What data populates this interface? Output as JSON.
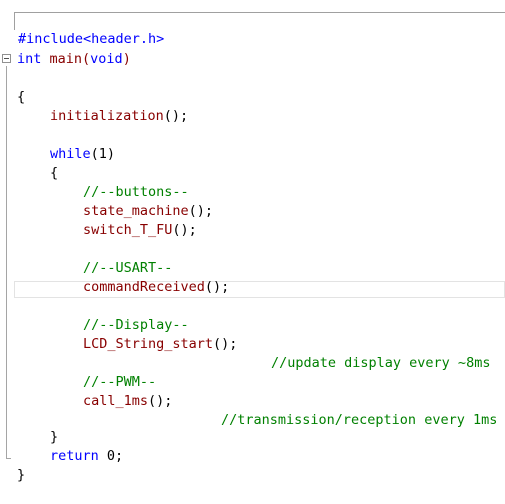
{
  "editor": {
    "lines": {
      "include": "#include<header.h>",
      "main_kw": "int",
      "main_rest": " main(",
      "main_void": "void",
      "main_close": ")",
      "open_brace": "{",
      "init_call": "initialization",
      "init_tail": "();",
      "while_kw": "while",
      "while_cond": "(1)",
      "while_open": "{",
      "cm_buttons": "//--buttons--",
      "state_machine": "state_machine",
      "state_tail": "();",
      "switch": "switch_T_FU",
      "switch_tail": "();",
      "cm_usart": "//--USART--",
      "command": "commandReceived",
      "command_tail": "();",
      "cm_display": "//--Display--",
      "lcd": "LCD_String_start",
      "lcd_tail": "();",
      "cm_update": "//update display every ~8ms",
      "cm_pwm": "//--PWM--",
      "call": "call_1ms",
      "call_tail": "();",
      "cm_trans": "//transmission/reception every 1ms",
      "while_close": "}",
      "return_kw": "return",
      "return_tail": " 0;",
      "close_brace": "}"
    }
  }
}
